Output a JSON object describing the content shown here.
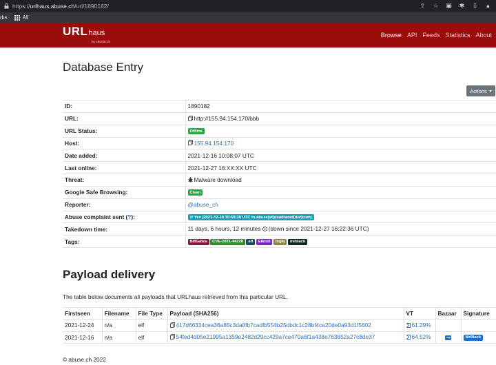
{
  "browser": {
    "url_prefix": "https://",
    "url_host": "urlhaus.abuse.ch",
    "url_path": "/url/1890182/",
    "bookmarks": [
      {
        "label": "rks"
      },
      {
        "label": "All"
      }
    ]
  },
  "navbar": {
    "brand_main": "URL",
    "brand_sub": "haus",
    "brand_by": "by ABUSE.ch",
    "links": [
      "Browse",
      "API",
      "Feeds",
      "Statistics",
      "About"
    ]
  },
  "page": {
    "title": "Database Entry",
    "actions_label": "Actions"
  },
  "entry": {
    "rows": [
      {
        "key": "ID:",
        "value": "1890182"
      },
      {
        "key": "URL:",
        "value": "http://155.94.154.170/bbb"
      },
      {
        "key": "URL Status:",
        "badge": "Offline"
      },
      {
        "key": "Host:",
        "value": "155.94.154.170"
      },
      {
        "key": "Date added:",
        "value": "2021-12-16 10:08:07 UTC"
      },
      {
        "key": "Last online:",
        "value": "2021-12-27 16:XX:XX UTC"
      },
      {
        "key": "Threat:",
        "value": "Malware download"
      },
      {
        "key": "Google Safe Browsing:",
        "badge": "Clean"
      },
      {
        "key": "Reporter:",
        "value": "@abuse_ch"
      },
      {
        "key_prefix": "Abuse complaint sent (",
        "key_link": "?",
        "key_suffix": "):",
        "badge": "Yes (2021-12-16 10:09:38 UTC to abuse[at]quadranet[dot]com)"
      },
      {
        "key": "Takedown time:",
        "value_a": "11 days, 6 hours, 12 minutes",
        "value_b": "(down since 2021-12-27 16:22:36 UTC)"
      },
      {
        "key": "Tags:"
      }
    ],
    "tags": [
      {
        "label": "BillGates",
        "color": "#8b1a3f"
      },
      {
        "label": "CVE-2021-44228",
        "color": "#2e8b30"
      },
      {
        "label": "elf",
        "color": "#1a4d5c"
      },
      {
        "label": "Elknot",
        "color": "#7a2cc9"
      },
      {
        "label": "log4j",
        "color": "#8a8a3a"
      },
      {
        "label": "mrblack",
        "color": "#0f2b22"
      }
    ],
    "colors": {
      "offline": "#28a745",
      "clean": "#28a745",
      "complaint": "#17a2b8"
    }
  },
  "payload_section": {
    "title": "Payload delivery",
    "description": "The table below documents all payloads that URLhaus retrieved from this particular URL.",
    "headers": [
      "Firstseen",
      "Filename",
      "File Type",
      "Payload (SHA256)",
      "VT",
      "Bazaar",
      "Signature"
    ],
    "rows": [
      {
        "firstseen": "2021-12-24",
        "filename": "n/a",
        "filetype": "elf",
        "sha256": "417d66334cea36a85c3da8fb7cadfb554b25dbdc1c28bf4ca20de0a93d1f5602",
        "vt": "61.29%",
        "bazaar": "",
        "signature": ""
      },
      {
        "firstseen": "2021-12-16",
        "filename": "n/a",
        "filetype": "elf",
        "sha256": "54fed4d05e21995a1359e2482d29cc429a7ce470a6f1a438e763852a27c8de37",
        "vt": "64.52%",
        "bazaar": "bazaar-icon",
        "signature": "MrBlack"
      }
    ]
  },
  "footer": {
    "text": "© abuse.ch 2022"
  }
}
